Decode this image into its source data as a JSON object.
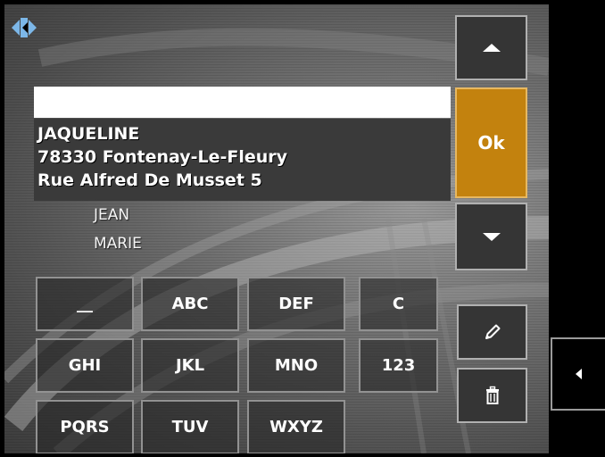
{
  "search": {
    "value": ""
  },
  "selected_entry": {
    "line1": "JAQUELINE",
    "line2": "78330 Fontenay-Le-Fleury",
    "line3": "Rue Alfred De Musset 5"
  },
  "list_items": [
    "JEAN",
    "MARIE"
  ],
  "keypad": {
    "row1": [
      "__",
      "ABC",
      "DEF",
      "C"
    ],
    "row2": [
      "GHI",
      "JKL",
      "MNO",
      "123"
    ],
    "row3": [
      "PQRS",
      "TUV",
      "WXYZ"
    ]
  },
  "buttons": {
    "ok": "Ok",
    "scroll_up_icon": "triangle-up",
    "scroll_down_icon": "triangle-down",
    "edit_icon": "pencil",
    "delete_icon": "trash",
    "back_icon": "triangle-left"
  },
  "colors": {
    "ok_button": "#c3820e",
    "logo": "#7cb7e8",
    "selected_band": "#3a3a3a"
  }
}
